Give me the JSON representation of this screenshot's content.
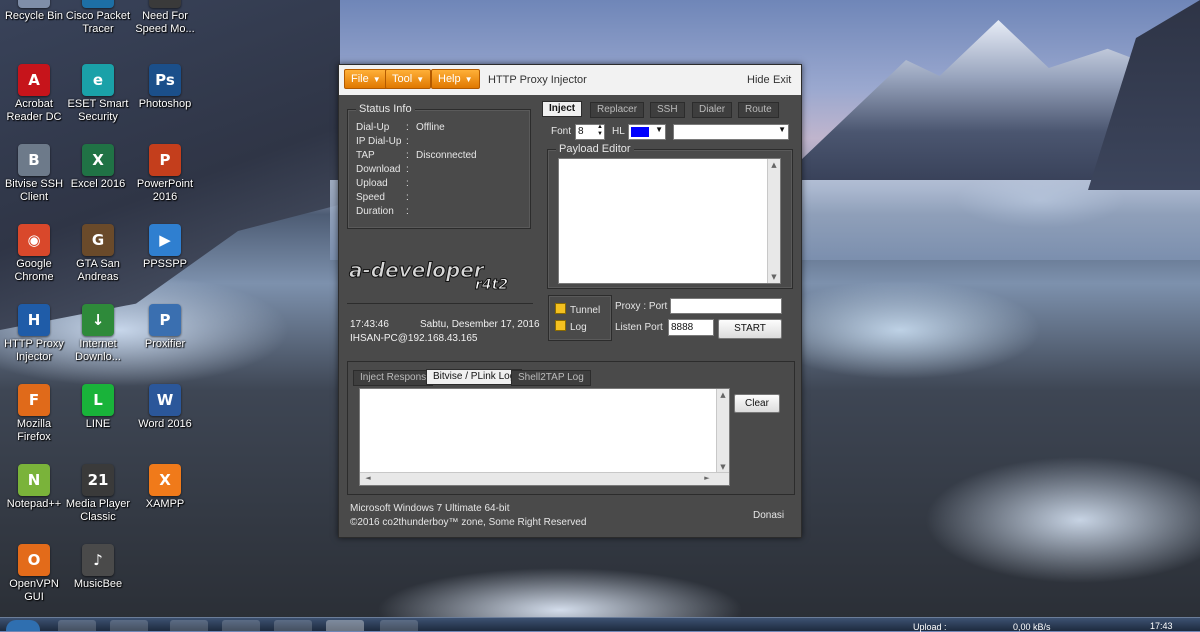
{
  "desktop": {
    "icons": [
      {
        "label": "Recycle Bin",
        "glyph": "🗑",
        "color": "#7f8ea8"
      },
      {
        "label": "Cisco Packet\nTracer",
        "glyph": "C",
        "color": "#1d6fa5"
      },
      {
        "label": "Need For\nSpeed Mo...",
        "glyph": "W",
        "color": "#3a3a3a"
      },
      {
        "label": "Acrobat\nReader DC",
        "glyph": "A",
        "color": "#c6141b"
      },
      {
        "label": "ESET Smart\nSecurity",
        "glyph": "e",
        "color": "#1aa1a8"
      },
      {
        "label": "Photoshop",
        "glyph": "Ps",
        "color": "#1b4f8a"
      },
      {
        "label": "Bitvise SSH\nClient",
        "glyph": "B",
        "color": "#6d7a8a"
      },
      {
        "label": "Excel 2016",
        "glyph": "X",
        "color": "#207245"
      },
      {
        "label": "PowerPoint\n2016",
        "glyph": "P",
        "color": "#c43e1c"
      },
      {
        "label": "Google\nChrome",
        "glyph": "◉",
        "color": "#d9482b"
      },
      {
        "label": "GTA San\nAndreas",
        "glyph": "G",
        "color": "#6a4a2a"
      },
      {
        "label": "PPSSPP",
        "glyph": "▶",
        "color": "#2f7fd0"
      },
      {
        "label": "HTTP Proxy\nInjector",
        "glyph": "H",
        "color": "#1f5ca8"
      },
      {
        "label": "Internet\nDownlo...",
        "glyph": "↓",
        "color": "#2e8a3a"
      },
      {
        "label": "Proxifier",
        "glyph": "P",
        "color": "#3a6fb0"
      },
      {
        "label": "Mozilla\nFirefox",
        "glyph": "F",
        "color": "#e06a1a"
      },
      {
        "label": "LINE",
        "glyph": "L",
        "color": "#19b33a"
      },
      {
        "label": "Word 2016",
        "glyph": "W",
        "color": "#2b579a"
      },
      {
        "label": "Notepad++",
        "glyph": "N",
        "color": "#7ab33a"
      },
      {
        "label": "Media Player\nClassic",
        "glyph": "21",
        "color": "#3a3a3a"
      },
      {
        "label": "XAMPP",
        "glyph": "X",
        "color": "#f07a1a"
      },
      {
        "label": "OpenVPN\nGUI",
        "glyph": "O",
        "color": "#e36b1a"
      },
      {
        "label": "MusicBee",
        "glyph": "♪",
        "color": "#4a4a4a"
      }
    ]
  },
  "window": {
    "title": "HTTP Proxy Injector",
    "menus": [
      "File",
      "Tool",
      "Help"
    ],
    "hide_label": "Hide",
    "exit_label": "Exit",
    "status_info": {
      "title": "Status Info",
      "rows": [
        {
          "key": "Dial-Up",
          "value": "Offline"
        },
        {
          "key": "IP Dial-Up",
          "value": ""
        },
        {
          "key": "TAP",
          "value": "Disconnected"
        },
        {
          "key": "Download",
          "value": ""
        },
        {
          "key": "Upload",
          "value": ""
        },
        {
          "key": "Speed",
          "value": ""
        },
        {
          "key": "Duration",
          "value": ""
        }
      ]
    },
    "logo_text": "a-developer",
    "logo_sub": "r4t2",
    "clock_time": "17:43:46",
    "clock_date": "Sabtu, Desember 17, 2016",
    "host": "IHSAN-PC@192.168.43.165",
    "tabs": [
      "Inject",
      "Replacer",
      "SSH",
      "Dialer",
      "Route"
    ],
    "font_label": "Font",
    "font_size": "8",
    "hl_label": "HL",
    "hl_color": "#0000ff",
    "payload_title": "Payload Editor",
    "payload_text": "",
    "tunnel_label": "Tunnel",
    "log_label": "Log",
    "proxy_port_label": "Proxy : Port",
    "proxy_port_value": "",
    "listen_port_label": "Listen Port",
    "listen_port_value": "8888",
    "start_label": "START",
    "log_tabs": [
      "Inject Respons",
      "Bitvise / PLink Log",
      "Shell2TAP Log"
    ],
    "clear_label": "Clear",
    "os_line": "Microsoft Windows 7 Ultimate  64-bit",
    "copyright": "©2016  co2thunderboy™ zone, Some Right Reserved",
    "donate_label": "Donasi"
  },
  "taskbar": {
    "upload_label": "Upload :",
    "upload_value": "0,00 kB/s",
    "time": "17:43"
  }
}
